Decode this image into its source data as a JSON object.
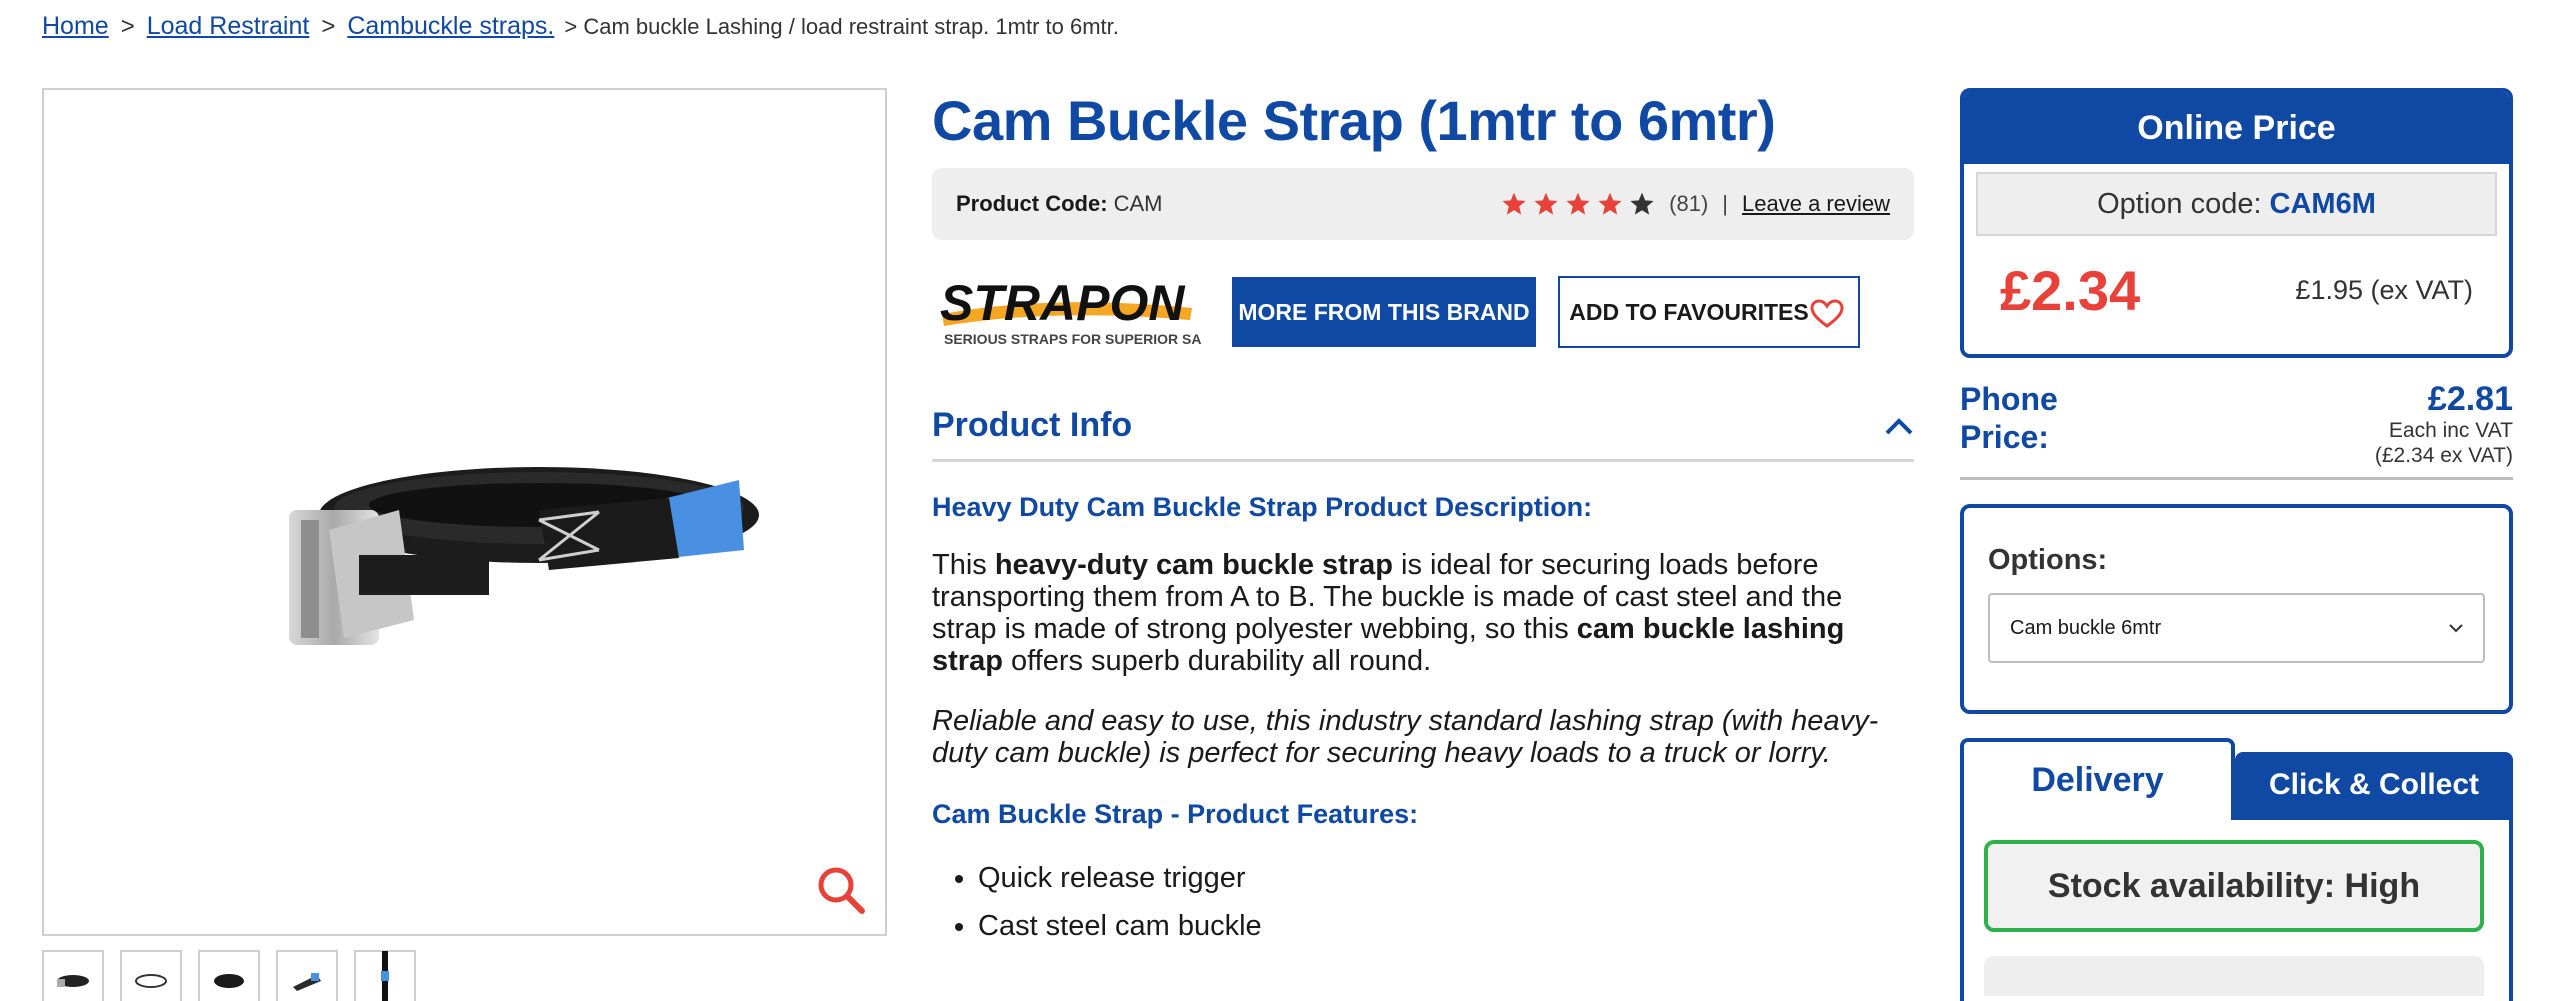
{
  "breadcrumb": {
    "home": "Home",
    "load_restraint": "Load Restraint",
    "cambuckle": "Cambuckle straps.",
    "current": "> Cam buckle Lashing / load restraint strap. 1mtr to 6mtr.",
    "sep1": ">",
    "sep2": ">"
  },
  "product": {
    "title": "Cam Buckle Strap (1mtr to 6mtr)",
    "code_label": "Product Code:",
    "code_value": "CAM",
    "rating": {
      "filled_stars": 4,
      "total_stars": 5,
      "count": "(81)",
      "separator": "|",
      "leave_review": "Leave a review"
    },
    "brand": {
      "logo_text": "STRAPON",
      "tagline": "SERIOUS STRAPS FOR SUPERIOR SAFETY"
    },
    "more_from_brand": "MORE FROM THIS BRAND",
    "add_to_favourites": "ADD TO FAVOURITES"
  },
  "info": {
    "accordion_title": "Product Info",
    "desc_heading": "Heavy Duty Cam Buckle Strap Product Description:",
    "desc_p_parts": [
      "This ",
      "heavy-duty cam buckle strap",
      " is ideal for securing loads before transporting them from A to B. The buckle is made of cast steel and the strap is made of strong polyester webbing, so this ",
      "cam buckle lashing strap",
      " offers superb durability all round."
    ],
    "desc_italic": "Reliable and easy to use, this industry standard lashing strap (with heavy-duty cam buckle) is perfect for securing heavy loads to a truck or lorry.",
    "features_heading": "Cam Buckle Strap - Product Features:",
    "features": [
      "Quick release trigger",
      "Cast steel cam buckle"
    ]
  },
  "pricing": {
    "online_price_title": "Online Price",
    "option_code_label": "Option code:",
    "option_code_value": "CAM6M",
    "price": "£2.34",
    "price_ex_vat": "£1.95 (ex VAT)",
    "phone_label": "Phone Price:",
    "phone_price": "£2.81",
    "phone_sub1": "Each inc VAT",
    "phone_sub2": "(£2.34 ex VAT)"
  },
  "options": {
    "label": "Options:",
    "selected": "Cam buckle 6mtr"
  },
  "delivery": {
    "tab_delivery": "Delivery",
    "tab_collect": "Click & Collect",
    "stock": "Stock availability: High"
  },
  "colors": {
    "brand_blue": "#1049a3",
    "price_red": "#e8413a",
    "stock_green": "#2eb14a",
    "star_red": "#e8413a"
  },
  "icons": {
    "zoom": "magnifier-icon",
    "heart": "heart-icon",
    "chevron_up": "chevron-up-icon",
    "chevron_down": "chevron-down-icon",
    "star": "star-icon"
  }
}
